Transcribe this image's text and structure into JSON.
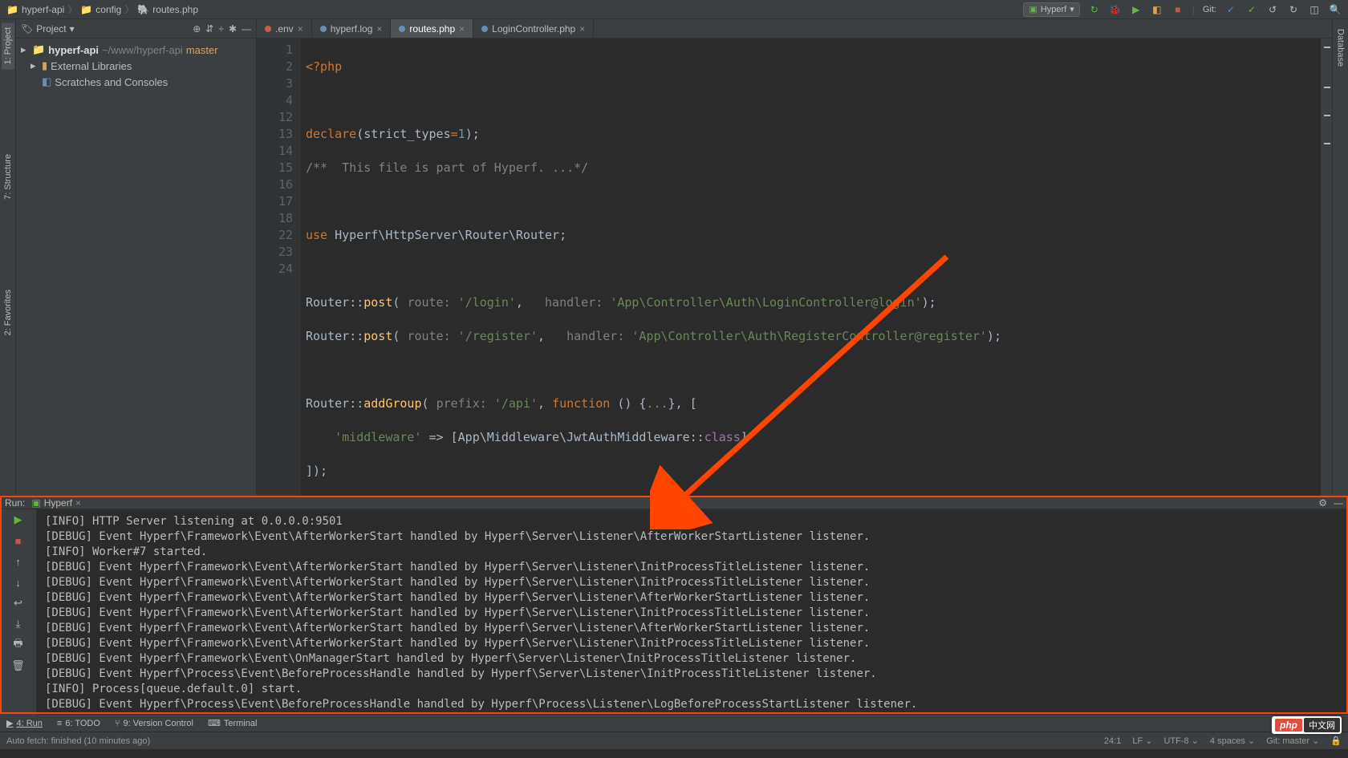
{
  "breadcrumb": {
    "item1": "hyperf-api",
    "item2": "config",
    "item3": "routes.php"
  },
  "topbar": {
    "run_config": "Hyperf",
    "git_label": "Git:"
  },
  "project": {
    "title": "Project",
    "root_name": "hyperf-api",
    "root_path": "~/www/hyperf-api",
    "root_branch": "master",
    "external": "External Libraries",
    "scratches": "Scratches and Consoles"
  },
  "sidebar": {
    "project": "1: Project",
    "structure": "7: Structure",
    "favorites": "2: Favorites",
    "database": "Database"
  },
  "editor_tabs": [
    {
      "label": ".env",
      "icon": "red"
    },
    {
      "label": "hyperf.log",
      "icon": "blue"
    },
    {
      "label": "routes.php",
      "icon": "blue",
      "active": true
    },
    {
      "label": "LoginController.php",
      "icon": "blue"
    }
  ],
  "gutter_lines": [
    "1",
    "2",
    "3",
    "4",
    "12",
    "13",
    "14",
    "15",
    "16",
    "17",
    "18",
    "22",
    "23",
    "24"
  ],
  "code": {
    "l1": "<?php",
    "l3_declare": "declare",
    "l3_rest": "(strict_types",
    "l3_eq": "=",
    "l3_num": "1",
    "l3_end": ");",
    "l4": "/**  This file is part of Hyperf. ...*/",
    "l13_use": "use ",
    "l13_ns": "Hyperf\\HttpServer\\Router\\Router;",
    "l15_router": "Router",
    "l15_scope": "::",
    "l15_post": "post",
    "l15_open": "( ",
    "l15_hint1": "route: ",
    "l15_str1": "'/login'",
    "l15_comma1": ",   ",
    "l15_hint2": "handler: ",
    "l15_str2": "'App\\Controller\\Auth\\LoginController@login'",
    "l15_end": ");",
    "l16_str1": "'/register'",
    "l16_str2": "'App\\Controller\\Auth\\RegisterController@register'",
    "l18_add": "addGroup",
    "l18_hintp": "prefix: ",
    "l18_str": "'/api'",
    "l18_comma": ", ",
    "l18_func": "function ",
    "l18_paren": "() {",
    "l18_fold": "...",
    "l18_close": "}, [",
    "l22_key": "'middleware'",
    "l22_arrow": " => ",
    "l22_open": "[",
    "l22_ns": "App\\Middleware\\JwtAuthMiddleware",
    "l22_scope": "::",
    "l22_class": "class",
    "l22_close": "]",
    "l23": "]);"
  },
  "run_panel": {
    "label": "Run:",
    "tab": "Hyperf"
  },
  "console_lines": [
    "[INFO] HTTP Server listening at 0.0.0.0:9501",
    "[DEBUG] Event Hyperf\\Framework\\Event\\AfterWorkerStart handled by Hyperf\\Server\\Listener\\AfterWorkerStartListener listener.",
    "[INFO] Worker#7 started.",
    "[DEBUG] Event Hyperf\\Framework\\Event\\AfterWorkerStart handled by Hyperf\\Server\\Listener\\InitProcessTitleListener listener.",
    "[DEBUG] Event Hyperf\\Framework\\Event\\AfterWorkerStart handled by Hyperf\\Server\\Listener\\InitProcessTitleListener listener.",
    "[DEBUG] Event Hyperf\\Framework\\Event\\AfterWorkerStart handled by Hyperf\\Server\\Listener\\AfterWorkerStartListener listener.",
    "[DEBUG] Event Hyperf\\Framework\\Event\\AfterWorkerStart handled by Hyperf\\Server\\Listener\\InitProcessTitleListener listener.",
    "[DEBUG] Event Hyperf\\Framework\\Event\\AfterWorkerStart handled by Hyperf\\Server\\Listener\\AfterWorkerStartListener listener.",
    "[DEBUG] Event Hyperf\\Framework\\Event\\AfterWorkerStart handled by Hyperf\\Server\\Listener\\InitProcessTitleListener listener.",
    "[DEBUG] Event Hyperf\\Framework\\Event\\OnManagerStart handled by Hyperf\\Server\\Listener\\InitProcessTitleListener listener.",
    "[DEBUG] Event Hyperf\\Process\\Event\\BeforeProcessHandle handled by Hyperf\\Server\\Listener\\InitProcessTitleListener listener.",
    "[INFO] Process[queue.default.0] start.",
    "[DEBUG] Event Hyperf\\Process\\Event\\BeforeProcessHandle handled by Hyperf\\Process\\Listener\\LogBeforeProcessStartListener listener."
  ],
  "bottom_tabs": {
    "run": "4: Run",
    "todo": "6: TODO",
    "vcs": "9: Version Control",
    "terminal": "Terminal"
  },
  "status": {
    "left": "Auto fetch: finished (10 minutes ago)",
    "pos": "24:1",
    "lf": "LF",
    "enc": "UTF-8",
    "indent": "4 spaces",
    "branch": "Git: master"
  },
  "badge": {
    "php": "php",
    "cn": "中文网"
  }
}
